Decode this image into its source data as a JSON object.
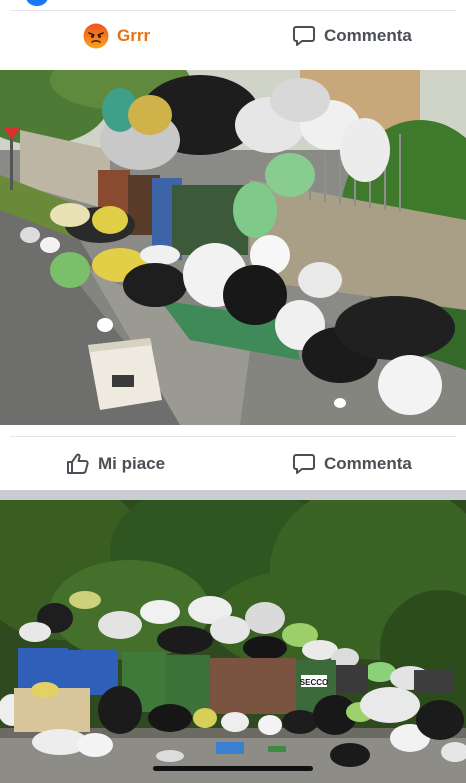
{
  "post1": {
    "reaction_label": "Grrr",
    "comment_label": "Commenta"
  },
  "post2": {
    "like_label": "Mi piace",
    "comment_label": "Commenta"
  },
  "photo2": {
    "bin_label": "SECCO"
  },
  "colors": {
    "reaction_orange": "#e9710f",
    "action_gray": "#4b4f56",
    "brand_blue": "#1877f2"
  },
  "icons": {
    "reaction": "angry-face-icon",
    "comment": "speech-bubble-icon",
    "like": "thumbs-up-icon"
  }
}
